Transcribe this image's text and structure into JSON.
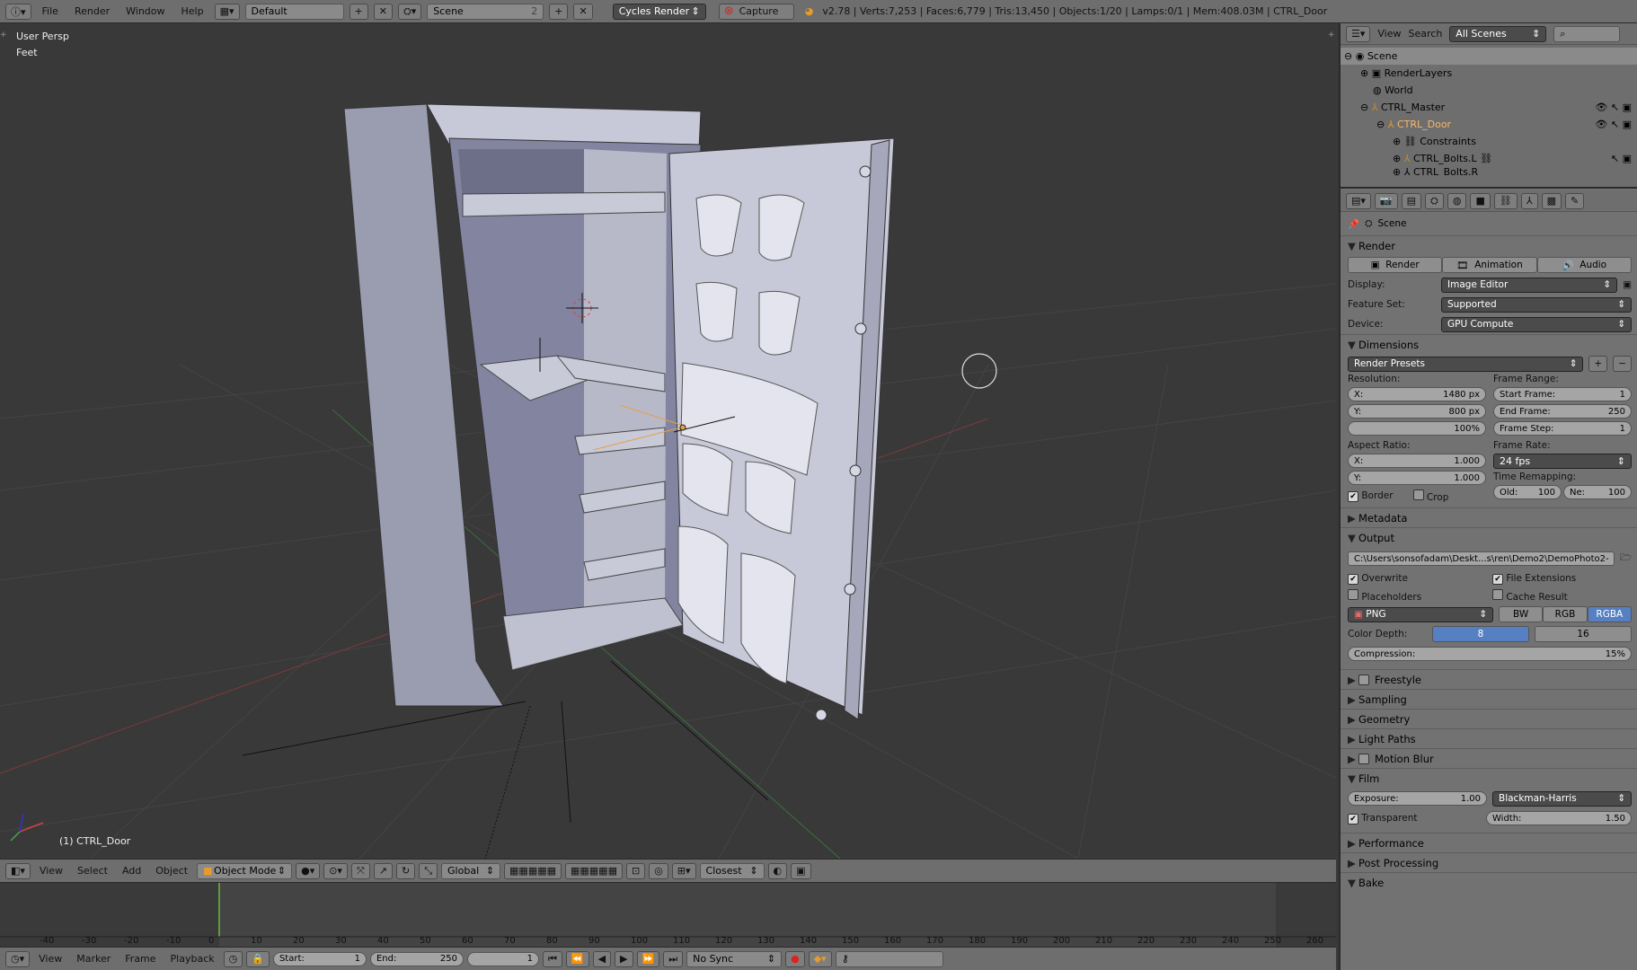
{
  "topbar": {
    "menus": [
      "File",
      "Render",
      "Window",
      "Help"
    ],
    "layout": "Default",
    "scene": "Scene",
    "scene_count": "2",
    "engine": "Cycles Render",
    "capture": "Capture",
    "stats": "v2.78 | Verts:7,253 | Faces:6,779 | Tris:13,450 | Objects:1/20 | Lamps:0/1 | Mem:408.03M | CTRL_Door"
  },
  "viewport": {
    "persp": "User Persp",
    "units": "Feet",
    "active_object": "(1) CTRL_Door"
  },
  "vp_header": {
    "menus": [
      "View",
      "Select",
      "Add",
      "Object"
    ],
    "mode": "Object Mode",
    "orientation": "Global",
    "snap": "Closest"
  },
  "timeline": {
    "ticks": [
      "-40",
      "-30",
      "-20",
      "-10",
      "0",
      "10",
      "20",
      "30",
      "40",
      "50",
      "60",
      "70",
      "80",
      "90",
      "100",
      "110",
      "120",
      "130",
      "140",
      "150",
      "160",
      "170",
      "180",
      "190",
      "200",
      "210",
      "220",
      "230",
      "240",
      "250",
      "260"
    ],
    "menus": [
      "View",
      "Marker",
      "Frame",
      "Playback"
    ],
    "start_label": "Start:",
    "start": "1",
    "end_label": "End:",
    "end": "250",
    "current": "1",
    "sync": "No Sync"
  },
  "outliner": {
    "menus": [
      "View",
      "Search"
    ],
    "filter": "All Scenes",
    "rows": [
      "Scene",
      "RenderLayers",
      "World",
      "CTRL_Master",
      "CTRL_Door",
      "Constraints",
      "CTRL_Bolts.L",
      "CTRL_Bolts.R"
    ]
  },
  "properties": {
    "context": "Scene",
    "render": {
      "title": "Render",
      "buttons": [
        "Render",
        "Animation",
        "Audio"
      ],
      "display_label": "Display:",
      "display": "Image Editor",
      "feature_label": "Feature Set:",
      "feature": "Supported",
      "device_label": "Device:",
      "device": "GPU Compute"
    },
    "dimensions": {
      "title": "Dimensions",
      "presets": "Render Presets",
      "resolution_label": "Resolution:",
      "res_x_label": "X:",
      "res_x": "1480 px",
      "res_y_label": "Y:",
      "res_y": "800 px",
      "res_pct": "100%",
      "frame_range_label": "Frame Range:",
      "start_label": "Start Frame:",
      "start": "1",
      "end_label": "End Frame:",
      "end": "250",
      "step_label": "Frame Step:",
      "step": "1",
      "aspect_label": "Aspect Ratio:",
      "asp_x_label": "X:",
      "asp_x": "1.000",
      "asp_y_label": "Y:",
      "asp_y": "1.000",
      "frame_rate_label": "Frame Rate:",
      "fps": "24 fps",
      "remap_label": "Time Remapping:",
      "old_label": "Old:",
      "old": "100",
      "new_label": "Ne:",
      "new": "100",
      "border": "Border",
      "crop": "Crop"
    },
    "metadata": "Metadata",
    "output": {
      "title": "Output",
      "path": "C:\\Users\\sonsofadam\\Deskt...s\\ren\\Demo2\\DemoPhoto2-",
      "overwrite": "Overwrite",
      "file_ext": "File Extensions",
      "placeholders": "Placeholders",
      "cache": "Cache Result",
      "format": "PNG",
      "modes": [
        "BW",
        "RGB",
        "RGBA"
      ],
      "depth_label": "Color Depth:",
      "depths": [
        "8",
        "16"
      ],
      "compression_label": "Compression:",
      "compression": "15%"
    },
    "collapsed": [
      "Freestyle",
      "Sampling",
      "Geometry",
      "Light Paths",
      "Motion Blur"
    ],
    "film": {
      "title": "Film",
      "exposure_label": "Exposure:",
      "exposure": "1.00",
      "filter": "Blackman-Harris",
      "transparent": "Transparent",
      "width_label": "Width:",
      "width": "1.50"
    },
    "tail": [
      "Performance",
      "Post Processing",
      "Bake"
    ]
  }
}
